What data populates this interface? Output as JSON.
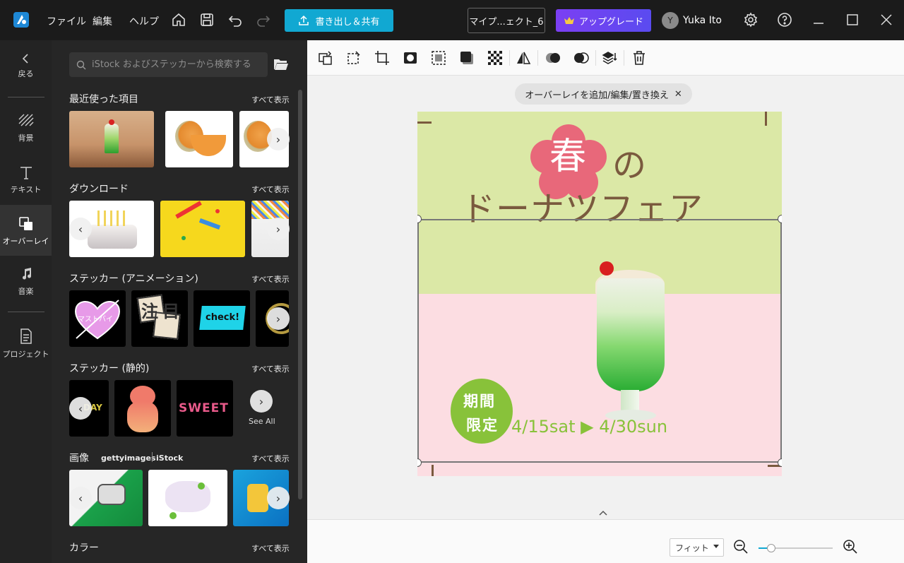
{
  "titlebar": {
    "menus": [
      "ファイル",
      "編集",
      "ヘルプ"
    ],
    "export_label": "書き出し＆共有",
    "project_name": "マイプ...ェクト_6",
    "upgrade_label": "アップグレード",
    "avatar_initial": "Y",
    "user_name": "Yuka Ito"
  },
  "rail": {
    "back": "戻る",
    "items": [
      {
        "label": "背景",
        "icon": "background-icon"
      },
      {
        "label": "テキスト",
        "icon": "text-icon"
      },
      {
        "label": "オーバーレイ",
        "icon": "overlay-icon",
        "active": true
      },
      {
        "label": "音楽",
        "icon": "music-icon"
      },
      {
        "label": "プロジェクト",
        "icon": "project-icon"
      }
    ]
  },
  "panel": {
    "search_placeholder": "iStock およびステッカーから検索する",
    "see_all": "すべて表示",
    "sections": {
      "recent": "最近使った項目",
      "download": "ダウンロード",
      "sticker_anim": "ステッカー (アニメーション)",
      "sticker_static": "ステッカー (静的)",
      "images": "画像",
      "color": "カラー"
    },
    "sticker_texts": {
      "heart": "マストバイ",
      "chumoku": "注目",
      "check": "check!",
      "day": "DAY",
      "sweet": "SWEET"
    },
    "see_all_en": "See All",
    "brand_getty": "gettyimages",
    "brand_istock": "iStock"
  },
  "editor": {
    "overlay_chip": "オーバーレイを追加/編集/置き換え",
    "canvas": {
      "haru": "春",
      "no": "の",
      "title": "ドーナツフェア",
      "badge_1": "期間",
      "badge_2": "限定",
      "dates": "4/15sat ▶ 4/30sun"
    },
    "zoom_label": "フィット",
    "zoom_level": 0.17
  },
  "colors": {
    "accent": "#11a8d2",
    "upgrade": "#7b3ff2",
    "canvas_top": "#dce8a8",
    "canvas_bottom": "#fcdde2",
    "flower": "#e8687a",
    "title_brown": "#7a5a3e",
    "badge_green": "#88c23a"
  }
}
